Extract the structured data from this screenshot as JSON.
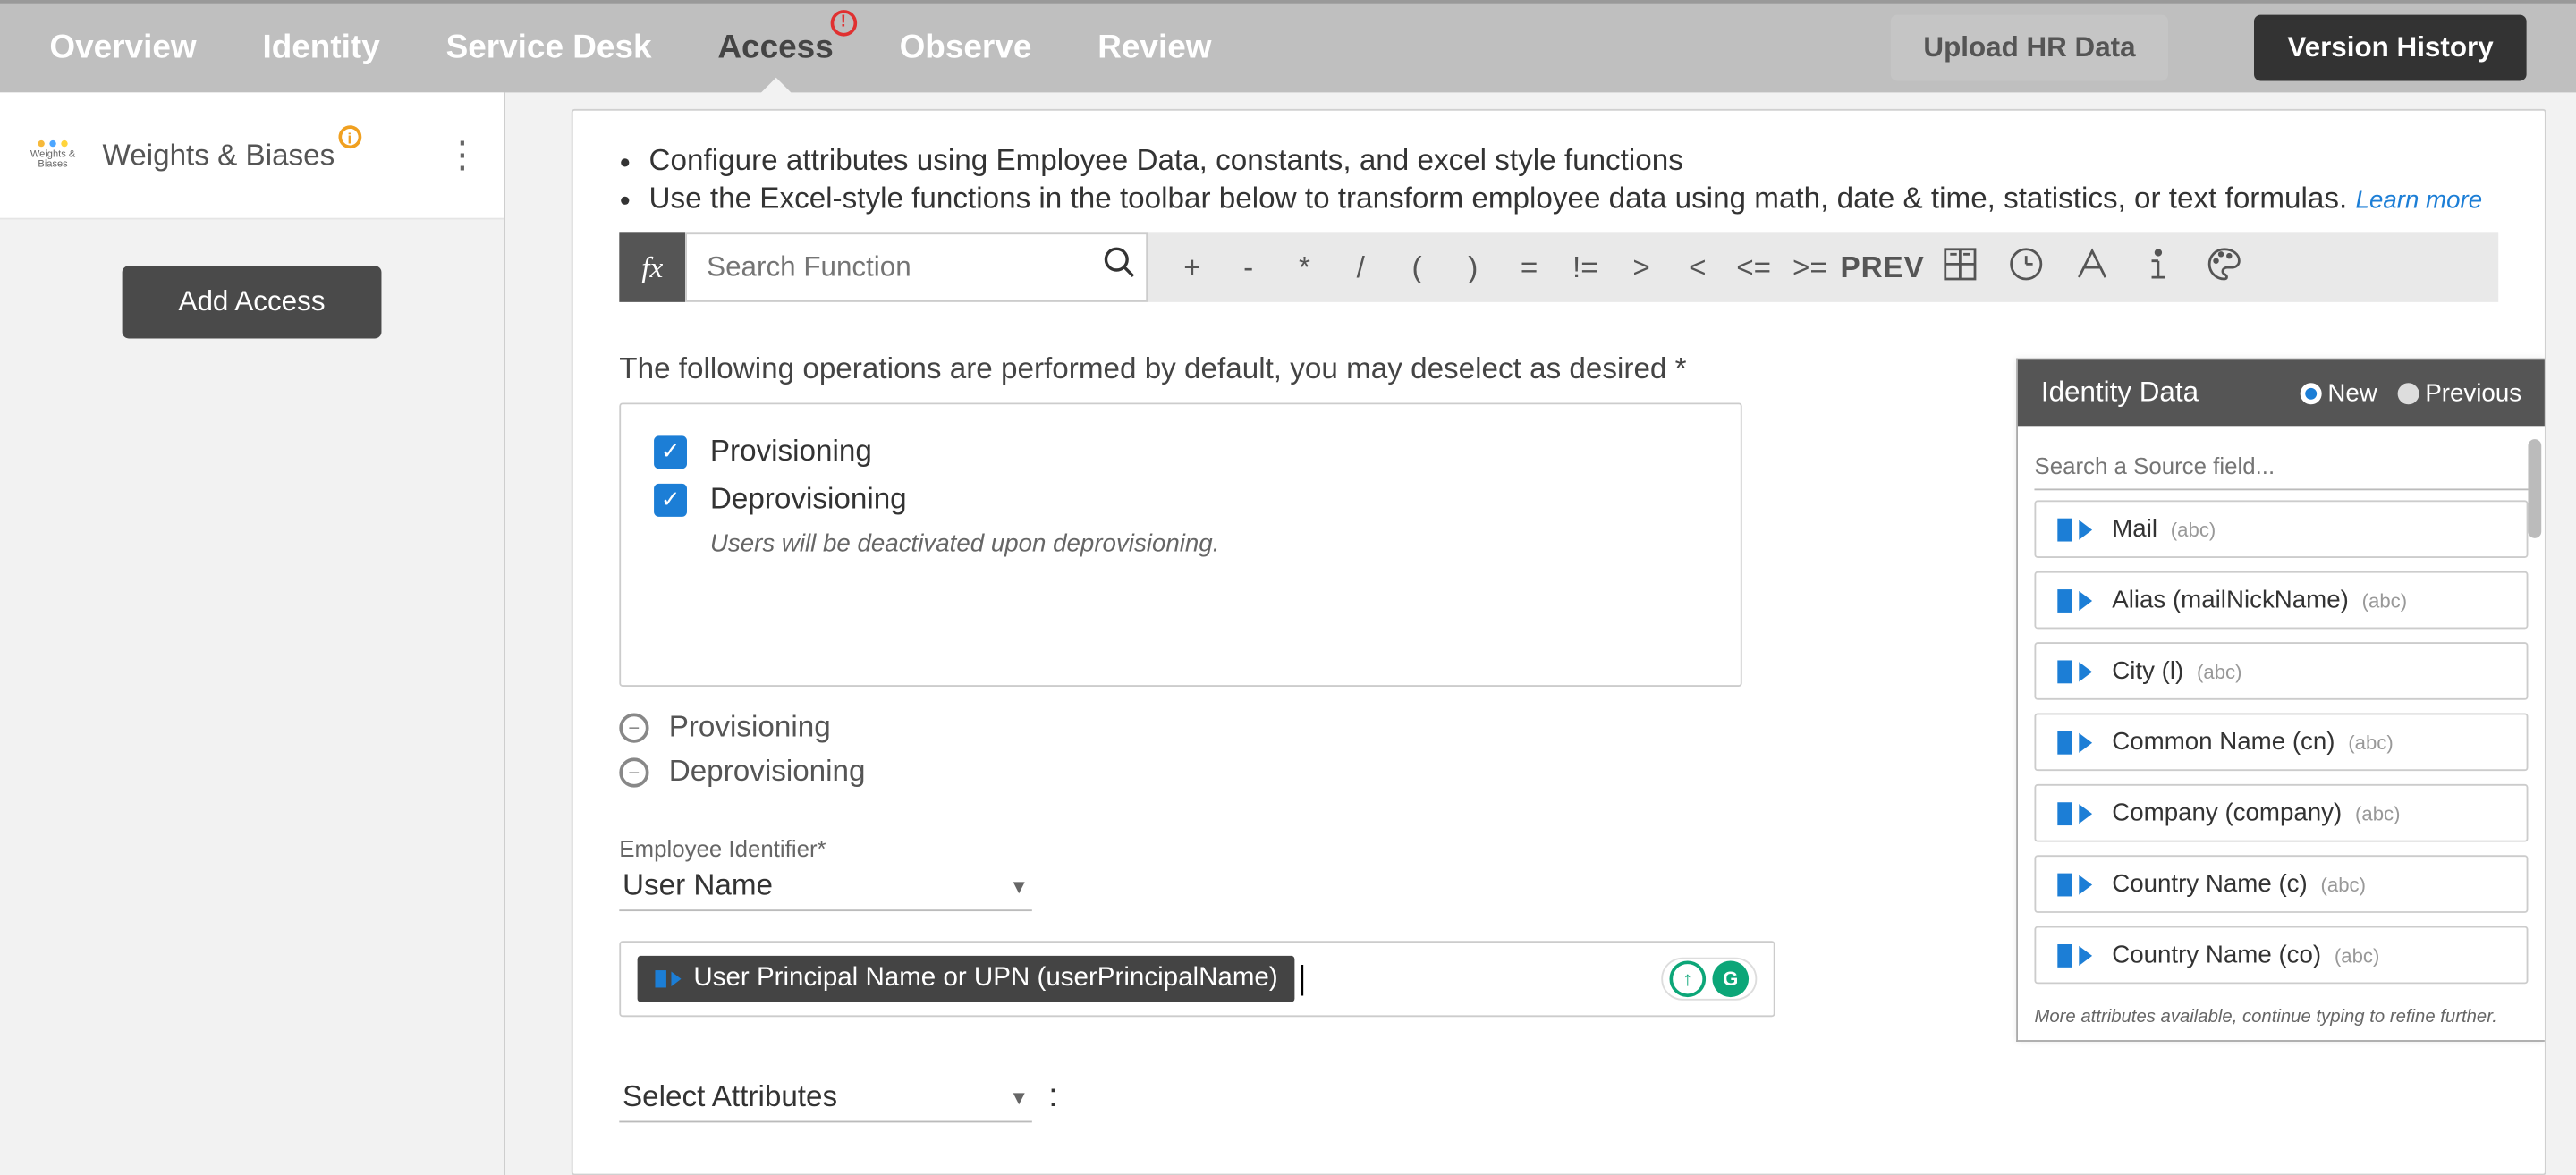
{
  "nav": {
    "items": [
      "Overview",
      "Identity",
      "Service Desk",
      "Access",
      "Observe",
      "Review"
    ],
    "active_index": 3,
    "alert_on_index": 3
  },
  "top_buttons": {
    "upload": "Upload HR Data",
    "history": "Version History"
  },
  "sidebar": {
    "app_name": "Weights & Biases",
    "app_sub": "Weights & Biases",
    "add_access": "Add Access"
  },
  "hints": {
    "b1": "Configure attributes using Employee Data, constants, and excel style functions",
    "b2": "Use the Excel-style functions in the toolbar below to transform employee data using math, date & time, statistics, or text formulas.",
    "learn_more": "Learn more"
  },
  "formula": {
    "fx": "fx",
    "search_placeholder": "Search Function",
    "ops": [
      "+",
      "-",
      "*",
      "/",
      "(",
      ")",
      "=",
      "!=",
      ">",
      "<",
      "<=",
      ">="
    ],
    "prev": "PREV"
  },
  "default_ops": {
    "intro": "The following operations are performed by default, you may deselect as desired *",
    "provisioning": "Provisioning",
    "deprovisioning": "Deprovisioning",
    "deprov_note": "Users will be deactivated upon deprovisioning.",
    "row_prov": "Provisioning",
    "row_deprov": "Deprovisioning"
  },
  "identifier": {
    "label": "Employee Identifier*",
    "value": "User Name",
    "token": "User Principal Name or UPN (userPrincipalName)"
  },
  "select_attr": {
    "label": "Select Attributes",
    "colon": ":"
  },
  "identity_panel": {
    "title": "Identity Data",
    "radio_new": "New",
    "radio_prev": "Previous",
    "search_placeholder": "Search a Source field...",
    "fields": [
      {
        "name": "Mail",
        "type": "(abc)"
      },
      {
        "name": "Alias (mailNickName)",
        "type": "(abc)"
      },
      {
        "name": "City (l)",
        "type": "(abc)"
      },
      {
        "name": "Common Name (cn)",
        "type": "(abc)"
      },
      {
        "name": "Company (company)",
        "type": "(abc)"
      },
      {
        "name": "Country Name (c)",
        "type": "(abc)"
      },
      {
        "name": "Country Name (co)",
        "type": "(abc)"
      }
    ],
    "more": "More attributes available, continue typing to refine further."
  }
}
